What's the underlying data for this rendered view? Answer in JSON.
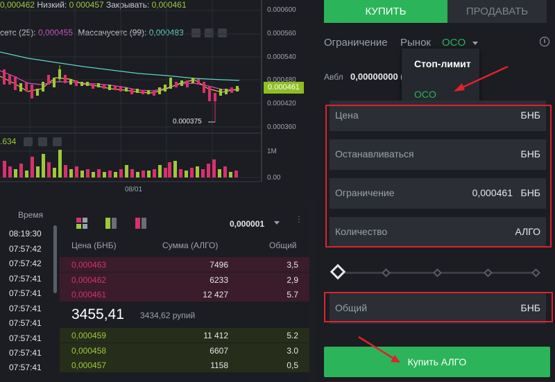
{
  "colors": {
    "up": "#9ec93a",
    "down": "#d9306e",
    "accent_green": "#2cb45a",
    "annotation_red": "#e0222d"
  },
  "chart": {
    "ohlc": {
      "open_value": "0,000462",
      "low_label": "Низкий:",
      "low_value": "0,000457",
      "close_label": "Закрывать:",
      "close_value": "0,000461"
    },
    "ma": {
      "ma25_label": "сетс (25):",
      "ma25_value": "0,000455",
      "ma99_label": "Массачусетс (99):",
      "ma99_value": "0,000483"
    },
    "price_ticks": [
      "0.000600",
      "0.000560",
      "0.000540",
      "0.000480",
      "0.000420",
      "0.000360"
    ],
    "current_price_tag": "0.000461",
    "low_marker": "0.000375",
    "volume_value": ".634",
    "volume_ticks": [
      "1M",
      "0.00"
    ],
    "date_label": "08/01"
  },
  "trades": {
    "header": "Время",
    "times": [
      "08:19:30",
      "07:57:42",
      "07:57:42",
      "07:57:41",
      "07:57:41",
      "07:57:41",
      "07:57:41",
      "07:57:41",
      "07:57:41",
      "07:57:41"
    ]
  },
  "orderbook": {
    "precision": "0,000001",
    "col_price": "Цена (БНБ)",
    "col_amount": "Сумма (АЛГО)",
    "col_total": "Общий",
    "asks": [
      {
        "price": "0,000463",
        "amount": "7496",
        "total": "3,5"
      },
      {
        "price": "0,000462",
        "amount": "6233",
        "total": "2,9"
      },
      {
        "price": "0,000461",
        "amount": "12 427",
        "total": "5.7"
      }
    ],
    "last_price": "3455,41",
    "last_price_fiat": "3434,62 рупий",
    "bids": [
      {
        "price": "0,000459",
        "amount": "11 412",
        "total": "5.2"
      },
      {
        "price": "0,000458",
        "amount": "6607",
        "total": "3.0"
      },
      {
        "price": "0,000457",
        "amount": "1158",
        "total": "0,5"
      }
    ]
  },
  "form": {
    "tab_buy": "КУПИТЬ",
    "tab_sell": "ПРОДАВАТЬ",
    "order_types": {
      "limit": "Ограничение",
      "market": "Рынок",
      "oco": "OCO"
    },
    "dropdown": {
      "stop_limit": "Стоп-лимит",
      "oco": "OCO"
    },
    "available_label": "Авбл",
    "available_value": "0,00000000 (",
    "fields": {
      "price_label": "Цена",
      "price_unit": "БНБ",
      "stop_label": "Останавливаться",
      "stop_unit": "БНБ",
      "limit_label": "Ограничение",
      "limit_value": "0,000461",
      "limit_unit": "БНБ",
      "qty_label": "Количество",
      "qty_unit": "АЛГО",
      "total_label": "Общий",
      "total_unit": "БНБ"
    },
    "submit": "Купить АЛГО"
  }
}
